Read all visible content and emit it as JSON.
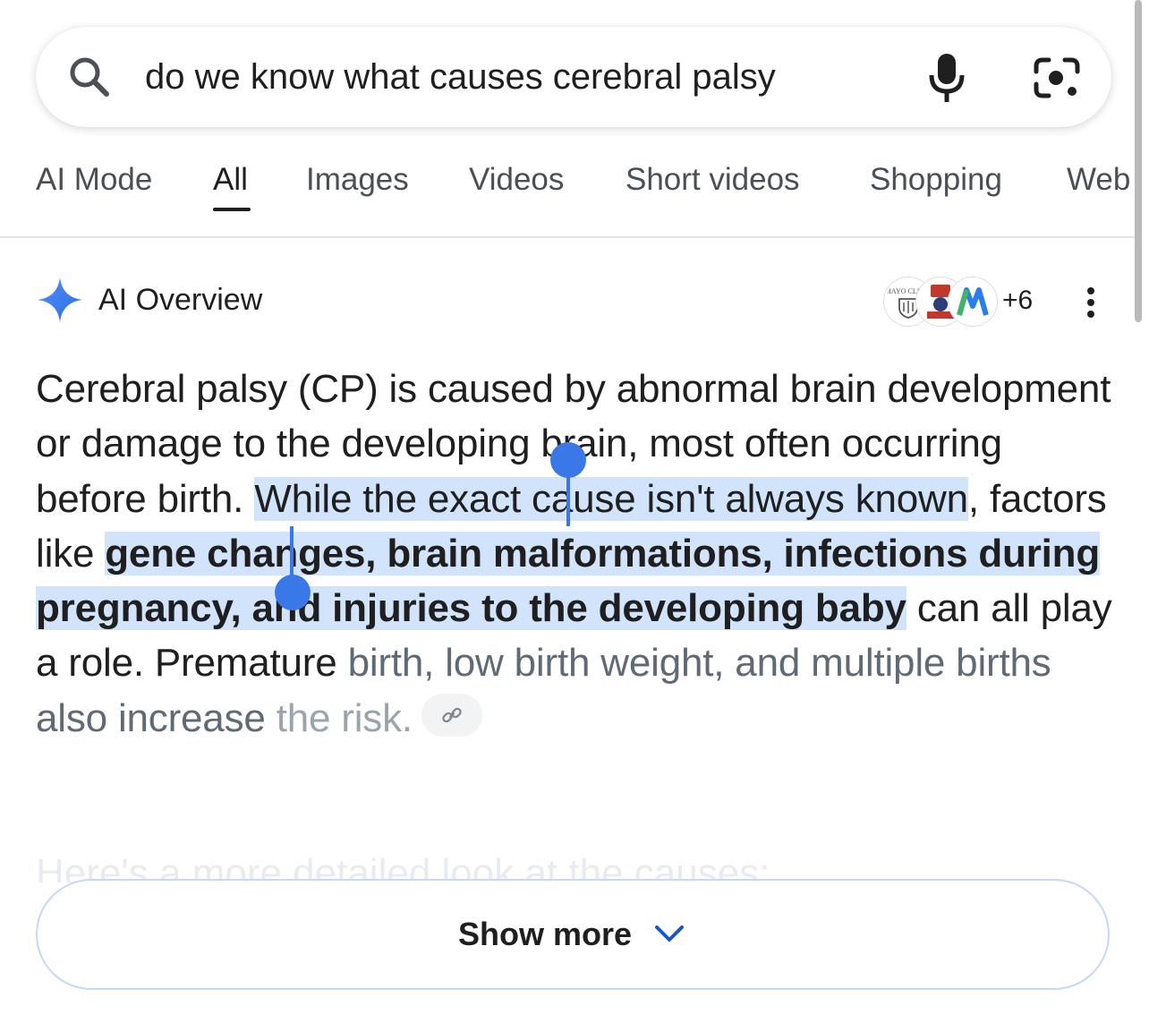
{
  "search": {
    "query": "do we know what causes cerebral palsy"
  },
  "tabs": [
    {
      "label": "AI Mode",
      "active": false
    },
    {
      "label": "All",
      "active": true
    },
    {
      "label": "Images",
      "active": false
    },
    {
      "label": "Videos",
      "active": false
    },
    {
      "label": "Short videos",
      "active": false
    },
    {
      "label": "Shopping",
      "active": false
    },
    {
      "label": "Web",
      "active": false
    }
  ],
  "ai_overview": {
    "title": "AI Overview",
    "source_count": "+6",
    "source_logos": [
      "mayo-clinic-logo",
      "red-logo",
      "blue-green-logo"
    ],
    "mayo_logo_text": "MAYO CLINIC",
    "paragraph": {
      "part1": "Cerebral palsy (CP) is caused by abnormal brain development or damage to the developing brain, most often occurring before birth. ",
      "selected": "While the exact cause isn't always known",
      "part2": ", factors like ",
      "highlight": "gene changes, brain malformations, infections during pregnancy, and injuries to the developing baby",
      "part3": " can all play a role. Premature ",
      "part4": "birth, low birth weight, and multiple births also increase ",
      "part5": "the risk."
    },
    "faded_next": "Here's a more detailed look at the causes:",
    "show_more_label": "Show more"
  },
  "colors": {
    "accent": "#3b78e7",
    "selection": "#d2e3fc",
    "gemini_blue": "#4285f4"
  }
}
